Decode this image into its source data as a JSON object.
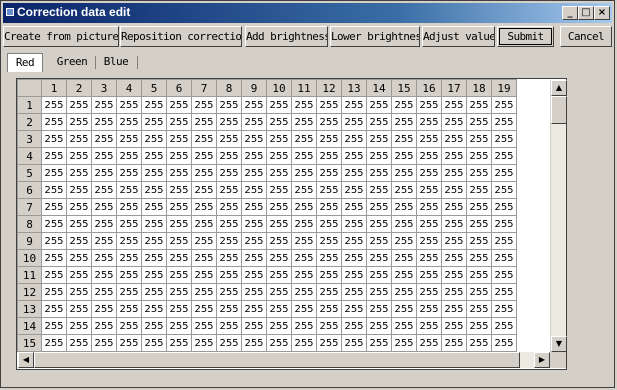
{
  "window": {
    "title": "Correction data edit",
    "minimize_glyph": "_",
    "maximize_glyph": "□",
    "close_glyph": "×"
  },
  "toolbar": {
    "create_from_picture": "Create from picture",
    "reposition_correction": "Reposition correction",
    "add_brightness": "Add brightness",
    "lower_brightness": "Lower brightness",
    "adjust_value": "Adjust value",
    "submit": "Submit",
    "cancel": "Cancel"
  },
  "tabs": [
    "Red",
    "Green",
    "Blue"
  ],
  "active_tab": "Red",
  "grid": {
    "column_headers": [
      "1",
      "2",
      "3",
      "4",
      "5",
      "6",
      "7",
      "8",
      "9",
      "10",
      "11",
      "12",
      "13",
      "14",
      "15",
      "16",
      "17",
      "18",
      "19"
    ],
    "row_headers": [
      "1",
      "2",
      "3",
      "4",
      "5",
      "6",
      "7",
      "8",
      "9",
      "10",
      "11",
      "12",
      "13",
      "14",
      "15"
    ],
    "cell_value": "255"
  },
  "scrollbars": {
    "up_arrow": "▲",
    "down_arrow": "▼",
    "left_arrow": "◀",
    "right_arrow": "▶"
  },
  "colors": {
    "title_bar_start": "#0a246a",
    "title_bar_end": "#a6caf0",
    "face": "#d4d0c8"
  }
}
